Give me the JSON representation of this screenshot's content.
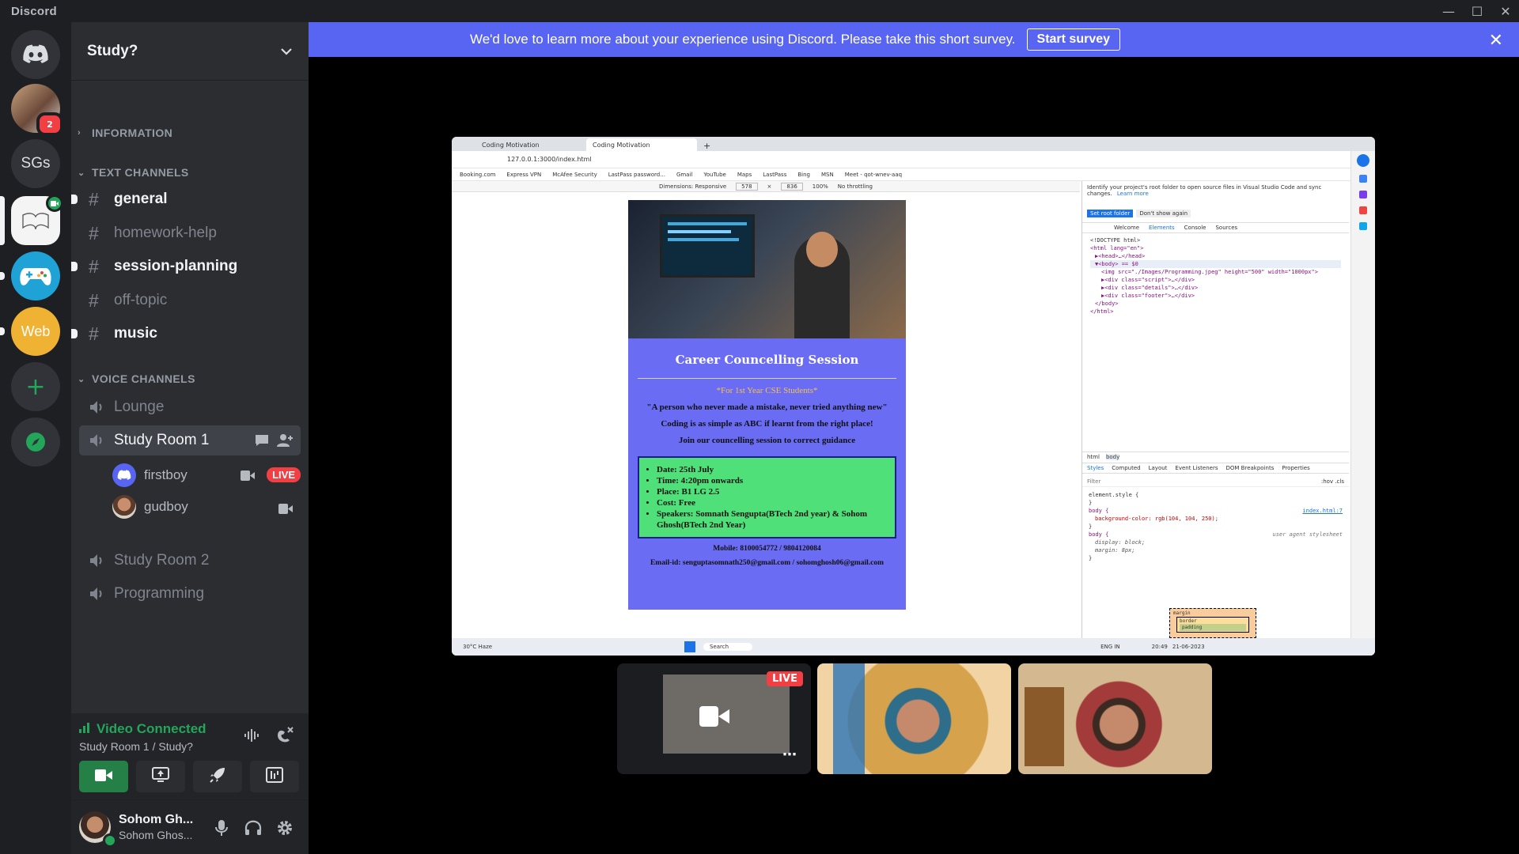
{
  "window": {
    "app_name": "Discord"
  },
  "notice": {
    "text": "We'd love to learn more about your experience using Discord. Please take this short survey.",
    "button": "Start survey"
  },
  "servers": [
    {
      "name": "Direct Messages",
      "badge": ""
    },
    {
      "name": "Profile server",
      "badge": "2"
    },
    {
      "name": "SGs",
      "label": "SGs"
    },
    {
      "name": "Study?"
    },
    {
      "name": "Game server"
    },
    {
      "name": "Web",
      "label": "Web"
    }
  ],
  "guild": {
    "name": "Study?"
  },
  "categories": {
    "information": "INFORMATION",
    "text": "TEXT CHANNELS",
    "voice": "VOICE CHANNELS"
  },
  "text_channels": [
    {
      "name": "general",
      "unread": true
    },
    {
      "name": "homework-help",
      "unread": false
    },
    {
      "name": "session-planning",
      "unread": true
    },
    {
      "name": "off-topic",
      "unread": false
    },
    {
      "name": "music",
      "unread": true
    }
  ],
  "voice_channels": [
    {
      "name": "Lounge"
    },
    {
      "name": "Study Room 1"
    },
    {
      "name": "Study Room 2"
    },
    {
      "name": "Programming"
    }
  ],
  "voice_users": [
    {
      "name": "firstboy",
      "live": "LIVE"
    },
    {
      "name": "gudboy"
    }
  ],
  "voice_panel": {
    "status": "Video Connected",
    "location": "Study Room 1 / Study?"
  },
  "user": {
    "display": "Sohom Gh...",
    "tag": "Sohom Ghos..."
  },
  "stream": {
    "tabs": [
      "Coding Motivation",
      "Coding Motivation"
    ],
    "url": "127.0.0.1:3000/index.html",
    "bookmarks": [
      "Booking.com",
      "Express VPN",
      "McAfee Security",
      "LastPass password...",
      "Gmail",
      "YouTube",
      "Maps",
      "LastPass",
      "Bing",
      "MSN",
      "Meet - qot-wnev-aaq"
    ],
    "device_toolbar": {
      "dimensions": "Dimensions: Responsive",
      "width": "578",
      "height": "836",
      "zoom": "100%",
      "throttle": "No throttling"
    },
    "page": {
      "title": "Career Councelling Session",
      "audience": "*For 1st Year CSE Students*",
      "quote": "\"A person who never made a mistake, never tried anything new\"",
      "line2": "Coding is as simple as ABC if learnt from the right place!",
      "line3": "Join our councelling session to correct guidance",
      "details": [
        "Date: 25th July",
        "Time: 4:20pm onwards",
        "Place: B1 LG 2.5",
        "Cost: Free",
        "Speakers: Somnath Sengupta(BTech 2nd year) & Sohom Ghosh(BTech 2nd Year)"
      ],
      "mobile": "Mobile: 8100054772 / 9804120084",
      "email": "Email-id: senguptasomnath250@gmail.com / sohomghosh06@gmail.com"
    },
    "devtools": {
      "info": "Identify your project's root folder to open source files in Visual Studio Code and sync changes.",
      "learn_more": "Learn more",
      "btn_root": "Set root folder",
      "btn_dismiss": "Don't show again",
      "tabs": [
        "Welcome",
        "Elements",
        "Console",
        "Sources"
      ],
      "code": [
        "<!DOCTYPE html>",
        "<html lang=\"en\">",
        "▶<head>…</head>",
        "▼<body> == $0",
        "<img src=\"./Images/Programming.jpeg\" height=\"500\" width=\"1000px\">",
        "▶<div class=\"script\">…</div>",
        "▶<div class=\"details\">…</div>",
        "▶<div class=\"footer\">…</div>",
        "</body>",
        "</html>"
      ],
      "crumbs": [
        "html",
        "body"
      ],
      "style_tabs": [
        "Styles",
        "Computed",
        "Layout",
        "Event Listeners",
        "DOM Breakpoints",
        "Properties"
      ],
      "filter": "Filter",
      "hov": ":hov .cls",
      "rules": [
        "element.style {",
        "}",
        "body {",
        "background-color: rgb(104, 104, 250);",
        "}",
        "body {",
        "display: block;",
        "margin: 8px;",
        "}"
      ],
      "rule_src": "index.html:7",
      "ua": "user agent stylesheet",
      "box": [
        "margin",
        "border",
        "padding"
      ]
    },
    "taskbar": {
      "weather": "30°C Haze",
      "search": "Search",
      "lang": "ENG IN",
      "time": "20:49",
      "date": "21-06-2023"
    }
  },
  "tiles": [
    {
      "live": "LIVE"
    }
  ],
  "colors": {
    "blurple": "#5865f2",
    "green": "#23a55a",
    "red": "#f23f43",
    "page_bg": "#6868fa",
    "details_bg": "#4fe07a"
  }
}
